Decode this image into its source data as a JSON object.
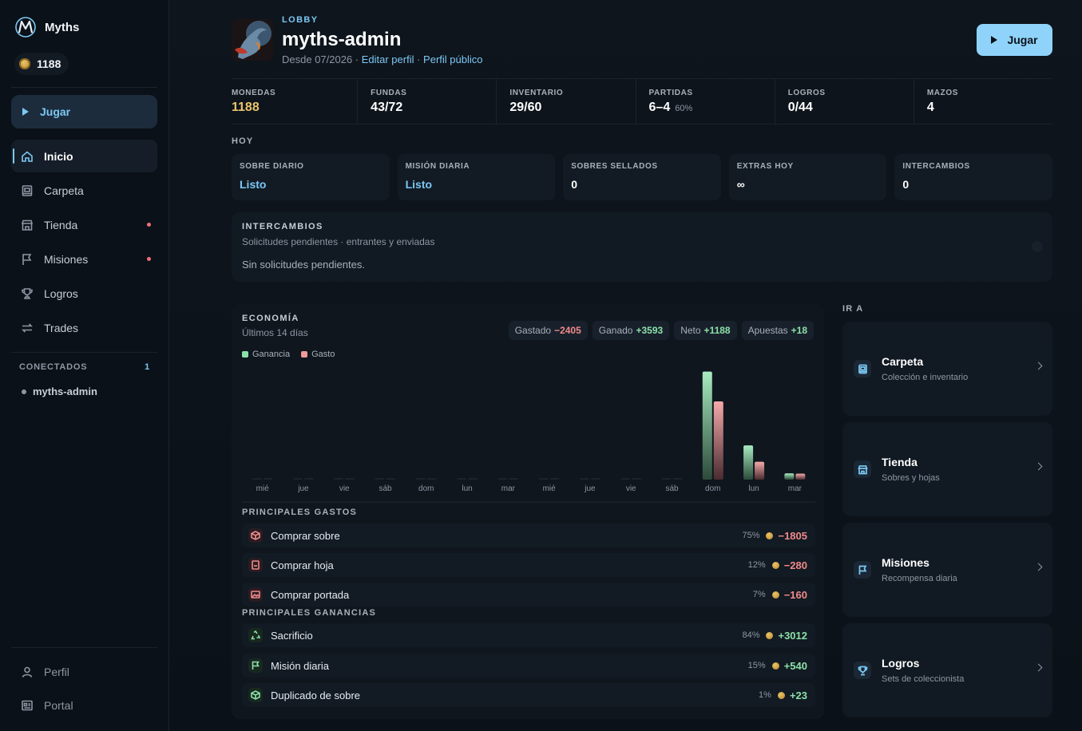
{
  "brand": {
    "name": "Myths",
    "coins": "1188"
  },
  "sidebar": {
    "play_label": "Jugar",
    "items": [
      {
        "label": "Inicio",
        "icon": "home-icon",
        "active": true,
        "badge": false
      },
      {
        "label": "Carpeta",
        "icon": "binder-icon",
        "active": false,
        "badge": false
      },
      {
        "label": "Tienda",
        "icon": "store-icon",
        "active": false,
        "badge": true
      },
      {
        "label": "Misiones",
        "icon": "flag-icon",
        "active": false,
        "badge": true
      },
      {
        "label": "Logros",
        "icon": "trophy-icon",
        "active": false,
        "badge": false
      },
      {
        "label": "Trades",
        "icon": "swap-icon",
        "active": false,
        "badge": false
      }
    ],
    "connected": {
      "label": "CONECTADOS",
      "count": "1",
      "users": [
        "myths-admin"
      ]
    },
    "bottom": [
      {
        "label": "Perfil",
        "icon": "user-icon"
      },
      {
        "label": "Portal",
        "icon": "portal-icon"
      }
    ]
  },
  "header": {
    "section": "LOBBY",
    "username": "myths-admin",
    "since": "Desde 07/2026 · ",
    "edit_link": "Editar perfil",
    "dot": " · ",
    "public_link": "Perfil público",
    "play_label": "Jugar"
  },
  "stats": [
    {
      "label": "MONEDAS",
      "value": "1188",
      "sub": ""
    },
    {
      "label": "FUNDAS",
      "value": "43/72",
      "sub": ""
    },
    {
      "label": "INVENTARIO",
      "value": "29/60",
      "sub": ""
    },
    {
      "label": "PARTIDAS",
      "value": "6–4",
      "sub": "60%"
    },
    {
      "label": "LOGROS",
      "value": "0/44",
      "sub": ""
    },
    {
      "label": "MAZOS",
      "value": "4",
      "sub": ""
    }
  ],
  "today": {
    "title": "HOY",
    "cards": [
      {
        "label": "SOBRE DIARIO",
        "value": "Listo"
      },
      {
        "label": "MISIÓN DIARIA",
        "value": "Listo"
      },
      {
        "label": "SOBRES SELLADOS",
        "value": "0"
      },
      {
        "label": "EXTRAS HOY",
        "value": "∞"
      },
      {
        "label": "INTERCAMBIOS",
        "value": "0"
      }
    ]
  },
  "trades": {
    "title": "INTERCAMBIOS",
    "subtitle": "Solicitudes pendientes · entrantes y enviadas",
    "empty": "Sin solicitudes pendientes."
  },
  "economy": {
    "title": "ECONOMÍA",
    "subtitle": "Últimos 14 días",
    "chips": [
      {
        "label": "Gastado",
        "value": "−2405",
        "tone": "neg"
      },
      {
        "label": "Ganado",
        "value": "+3593",
        "tone": "pos"
      },
      {
        "label": "Neto",
        "value": "+1188",
        "tone": "pos"
      },
      {
        "label": "Apuestas",
        "value": "+18",
        "tone": "pos"
      }
    ],
    "legend": [
      "Ganancia",
      "Gasto"
    ],
    "spend_title": "PRINCIPALES GASTOS",
    "spend": [
      {
        "name": "Comprar sobre",
        "pct": "75%",
        "value": "−1805",
        "icon": "package-icon"
      },
      {
        "name": "Comprar hoja",
        "pct": "12%",
        "value": "−280",
        "icon": "sheet-icon"
      },
      {
        "name": "Comprar portada",
        "pct": "7%",
        "value": "−160",
        "icon": "image-icon"
      }
    ],
    "earn_title": "PRINCIPALES GANANCIAS",
    "earn": [
      {
        "name": "Sacrificio",
        "pct": "84%",
        "value": "+3012",
        "icon": "recycle-icon"
      },
      {
        "name": "Misión diaria",
        "pct": "15%",
        "value": "+540",
        "icon": "flag-icon"
      },
      {
        "name": "Duplicado de sobre",
        "pct": "1%",
        "value": "+23",
        "icon": "package-icon"
      }
    ]
  },
  "goto": {
    "title": "IR A",
    "items": [
      {
        "title": "Carpeta",
        "sub": "Colección e inventario",
        "icon": "binder-icon"
      },
      {
        "title": "Tienda",
        "sub": "Sobres y hojas",
        "icon": "store-icon"
      },
      {
        "title": "Misiones",
        "sub": "Recompensa diaria",
        "icon": "flag-icon"
      },
      {
        "title": "Logros",
        "sub": "Sets de coleccionista",
        "icon": "trophy-icon"
      }
    ]
  },
  "colors": {
    "accent": "#7cc8f4",
    "gain": "#8be0a8",
    "spend": "#f08a8a",
    "gold": "#e9c46a"
  },
  "chart_data": {
    "type": "bar",
    "categories": [
      "mié",
      "jue",
      "vie",
      "sáb",
      "dom",
      "lun",
      "mar",
      "mié",
      "jue",
      "vie",
      "sáb",
      "dom",
      "lun",
      "mar"
    ],
    "series": [
      {
        "name": "Ganancia",
        "values": [
          0,
          0,
          0,
          0,
          0,
          0,
          0,
          0,
          0,
          0,
          0,
          2900,
          920,
          170
        ]
      },
      {
        "name": "Gasto",
        "values": [
          0,
          0,
          0,
          0,
          0,
          0,
          0,
          0,
          0,
          0,
          0,
          2100,
          480,
          160
        ]
      }
    ],
    "ylim": [
      0,
      3000
    ]
  }
}
